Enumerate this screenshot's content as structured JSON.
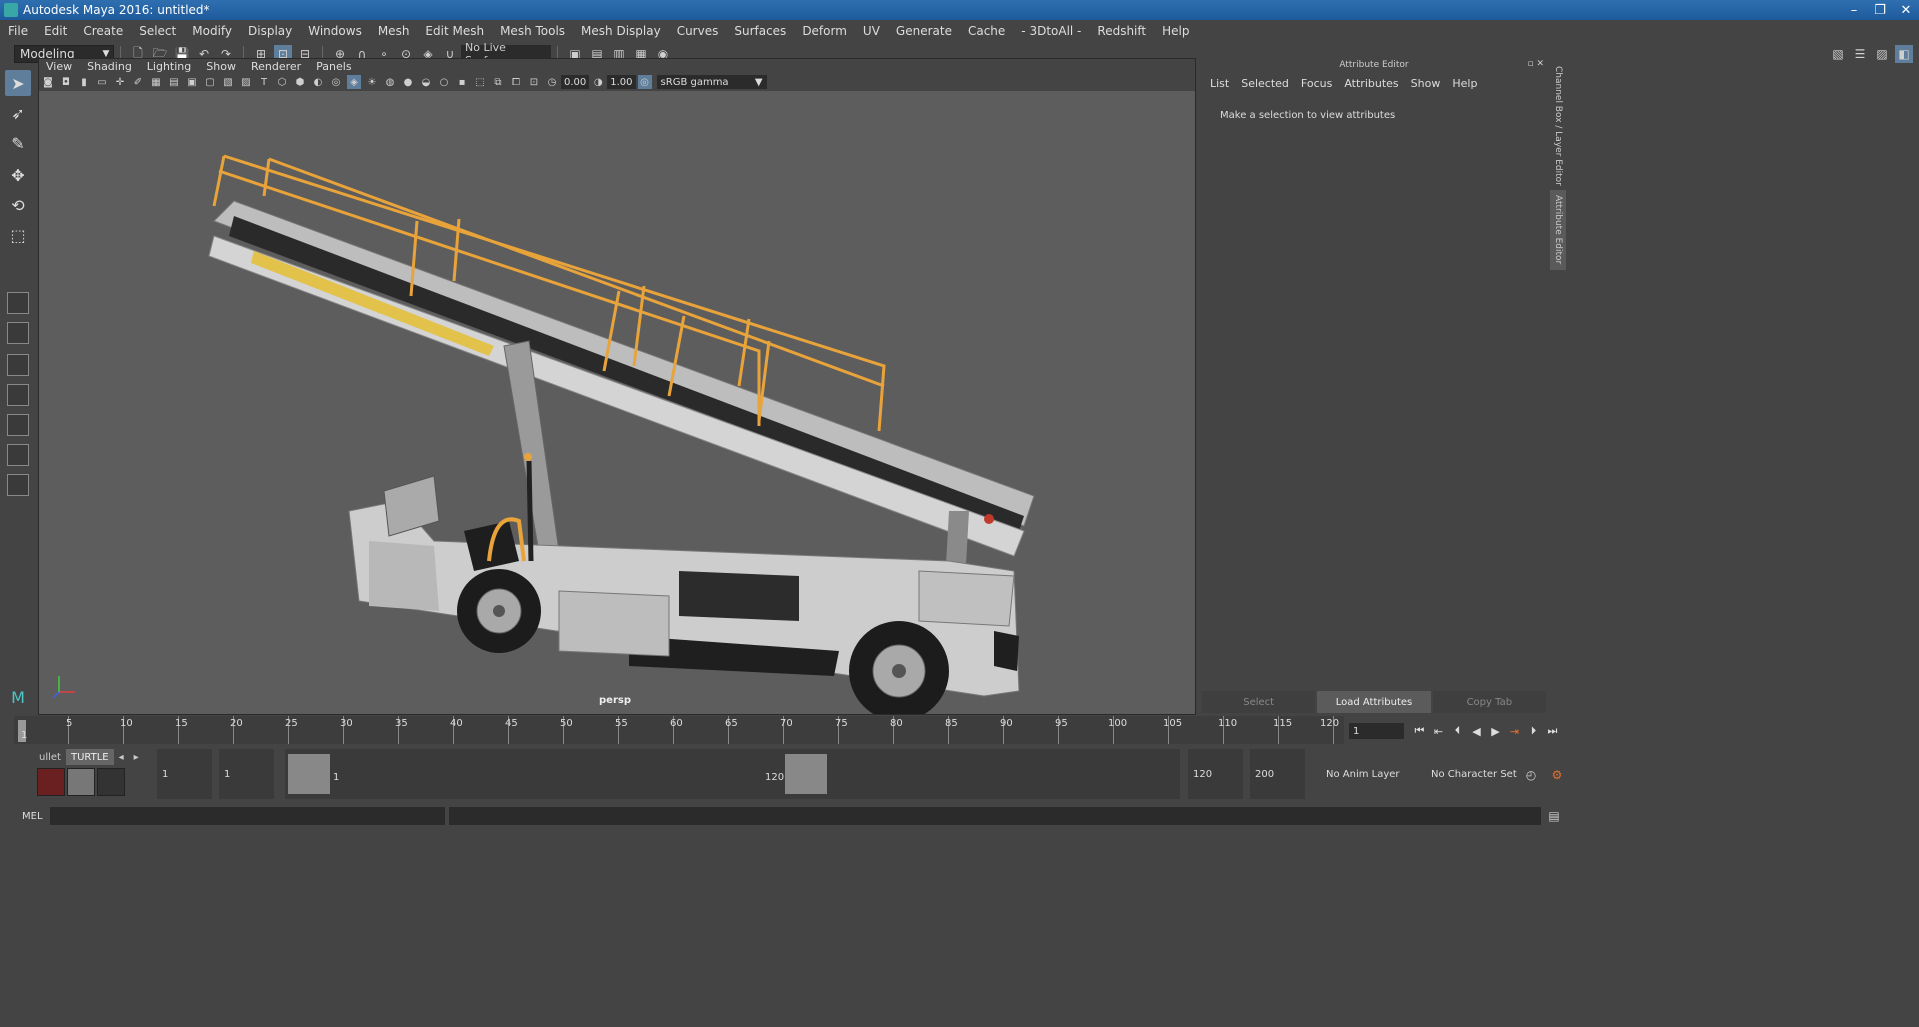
{
  "window": {
    "title": "Autodesk Maya 2016: untitled*",
    "min": "–",
    "max": "❐",
    "close": "✕"
  },
  "menubar": [
    "File",
    "Edit",
    "Create",
    "Select",
    "Modify",
    "Display",
    "Windows",
    "Mesh",
    "Edit Mesh",
    "Mesh Tools",
    "Mesh Display",
    "Curves",
    "Surfaces",
    "Deform",
    "UV",
    "Generate",
    "Cache",
    "- 3DtoAll -",
    "Redshift",
    "Help"
  ],
  "toolbar": {
    "mode": "Modeling",
    "live_surface": "No Live Surface"
  },
  "viewport": {
    "menu": [
      "View",
      "Shading",
      "Lighting",
      "Show",
      "Renderer",
      "Panels"
    ],
    "exposure": "0.00",
    "gamma": "1.00",
    "colorspace": "sRGB gamma",
    "camera": "persp"
  },
  "attribute_editor": {
    "title": "Attribute Editor",
    "menu": [
      "List",
      "Selected",
      "Focus",
      "Attributes",
      "Show",
      "Help"
    ],
    "message": "Make a selection to view attributes",
    "buttons": [
      "Select",
      "Load Attributes",
      "Copy Tab"
    ]
  },
  "side_tabs": [
    "Channel Box / Layer Editor",
    "Attribute Editor"
  ],
  "timeline": {
    "ticks": [
      "5",
      "10",
      "15",
      "20",
      "25",
      "30",
      "35",
      "40",
      "45",
      "50",
      "55",
      "60",
      "65",
      "70",
      "75",
      "80",
      "85",
      "90",
      "95",
      "100",
      "105",
      "110",
      "115",
      "120"
    ],
    "current_frame": "1",
    "start_marker": "1",
    "frame_field": "1"
  },
  "range": {
    "shelf_tabs": [
      "ullet",
      "TURTLE"
    ],
    "start": "1",
    "playback_start": "1",
    "handle_start": "1",
    "handle_end": "120",
    "playback_end": "120",
    "end": "200",
    "anim_layer": "No Anim Layer",
    "char_set": "No Character Set"
  },
  "cmdline": {
    "label": "MEL"
  },
  "colors": {
    "viewport_bg": "#5d5d5d",
    "ui_bg": "#444444",
    "railing": "#e8a33a",
    "body": "#c9c9c9"
  }
}
